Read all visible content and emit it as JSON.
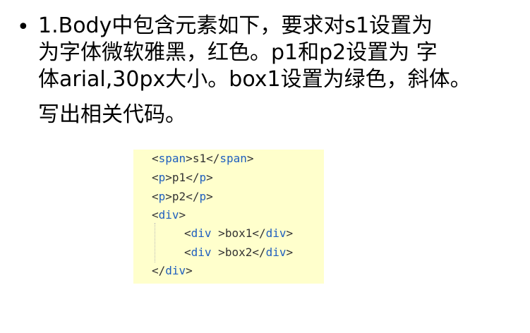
{
  "slide": {
    "bullet_symbol": "•",
    "lines": [
      "1.Body中包含元素如下，要求对s1设置为",
      "为字体微软雅黑，红色。p1和p2设置为 字",
      "体arial,30px大小。box1设置为绿色，斜体。",
      "写出相关代码。"
    ]
  },
  "code": {
    "lines": [
      {
        "open_tag": "span",
        "text": "s1",
        "close_tag": "span"
      },
      {
        "open_tag": "p",
        "text": "p1",
        "close_tag": "p"
      },
      {
        "open_tag": "p",
        "text": "p2",
        "close_tag": "p"
      },
      {
        "open_tag": "div",
        "text": "",
        "close_tag": ""
      },
      {
        "open_tag": "div ",
        "text": "box1",
        "close_tag": "div"
      },
      {
        "open_tag": "div ",
        "text": "box2",
        "close_tag": "div"
      },
      {
        "open_tag": "",
        "text": "",
        "close_tag": "div"
      }
    ]
  },
  "colors": {
    "code_background": "#ffffcc",
    "code_tag": "#1f5fbf",
    "code_text": "#333333",
    "slide_text": "#000000"
  }
}
